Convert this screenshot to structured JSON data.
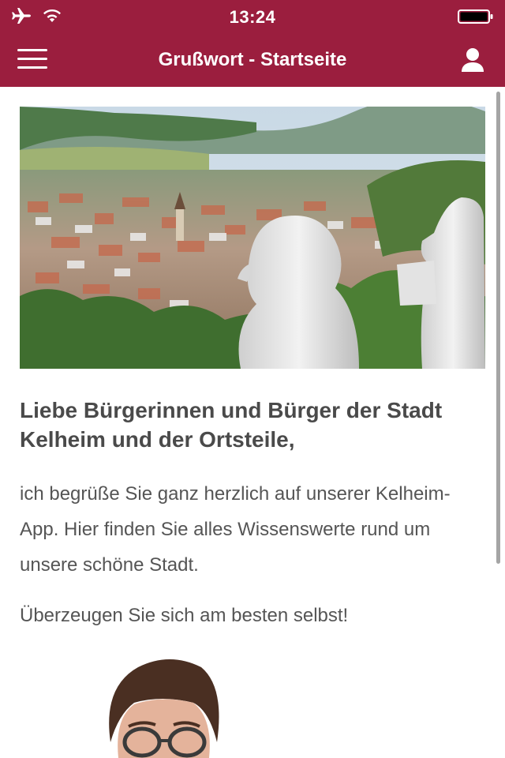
{
  "status_bar": {
    "time": "13:24",
    "icons": [
      "airplane-icon",
      "wifi-icon",
      "battery-icon"
    ]
  },
  "nav": {
    "title": "Grußwort - Startseite",
    "menu_icon": "hamburger-icon",
    "user_icon": "user-icon"
  },
  "colors": {
    "brand": "#9b1e3e",
    "heading_text": "#4a4a4a",
    "body_text": "#555555"
  },
  "content": {
    "heading": "Liebe Bürgerinnen und Bürger der Stadt Kelheim und der Ortsteile,",
    "paragraph": "ich begrüße Sie ganz herzlich auf unserer Kelheim-App. Hier finden Sie alles Wissenswerte rund um unsere schöne Stadt.",
    "paragraph2": "Überzeugen Sie sich am besten selbst!"
  }
}
